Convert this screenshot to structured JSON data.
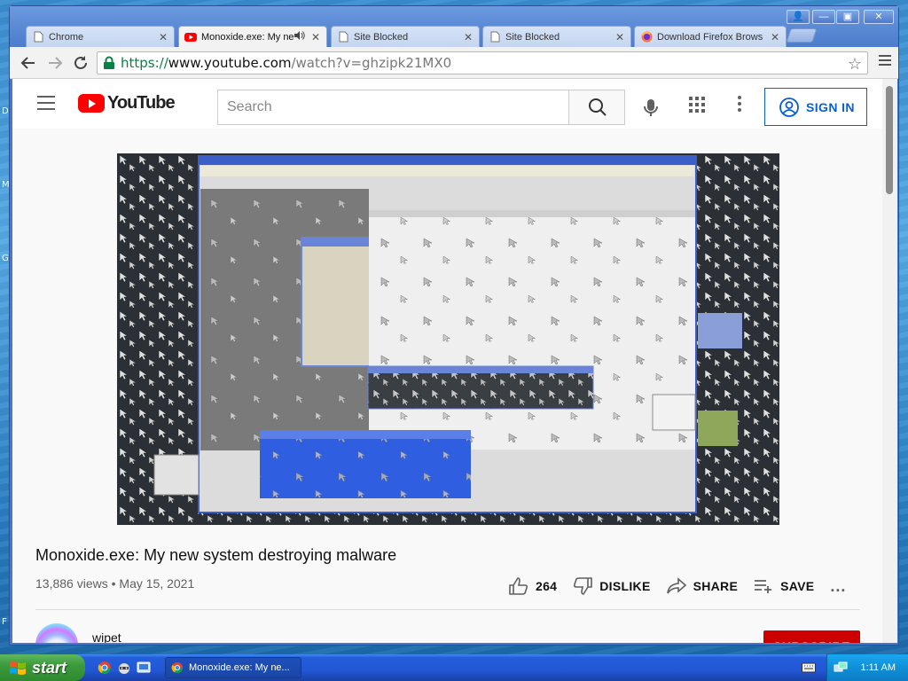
{
  "desktop": {
    "edge_letters": [
      "D",
      "M",
      "G",
      "F"
    ]
  },
  "browser": {
    "tabs": [
      {
        "title": "Chrome",
        "icon": "page-icon",
        "active": false
      },
      {
        "title": "Monoxide.exe: My ne",
        "icon": "youtube-icon",
        "active": true,
        "audio": true
      },
      {
        "title": "Site Blocked",
        "icon": "page-icon",
        "active": false
      },
      {
        "title": "Site Blocked",
        "icon": "page-icon",
        "active": false
      },
      {
        "title": "Download Firefox Brows",
        "icon": "firefox-icon",
        "active": false
      }
    ],
    "close_glyph": "✕",
    "window_controls": [
      "👤",
      "—",
      "▣",
      "✕"
    ],
    "url": {
      "scheme": "https://",
      "host": "www.youtube.com",
      "path": "/watch?v=ghzipk21MX0"
    }
  },
  "youtube": {
    "logo_text": "YouTube",
    "search_placeholder": "Search",
    "sign_in_label": "SIGN IN",
    "video": {
      "title": "Monoxide.exe: My new system destroying malware",
      "views": "13,886 views",
      "date": "May 15, 2021",
      "likes": "264",
      "dislike_label": "DISLIKE",
      "share_label": "SHARE",
      "save_label": "SAVE",
      "more_label": "..."
    },
    "channel": {
      "name": "wipet"
    },
    "subscribe_label": "SUBSCRIBE"
  },
  "taskbar": {
    "start_label": "start",
    "task_item": "Monoxide.exe: My ne...",
    "clock": "1:11 AM"
  },
  "colors": {
    "youtube_red": "#ff0000",
    "link_blue": "#065fd4",
    "subscribe_red": "#cc0000",
    "xp_blue": "#245edb",
    "start_green": "#3c9a3c"
  }
}
